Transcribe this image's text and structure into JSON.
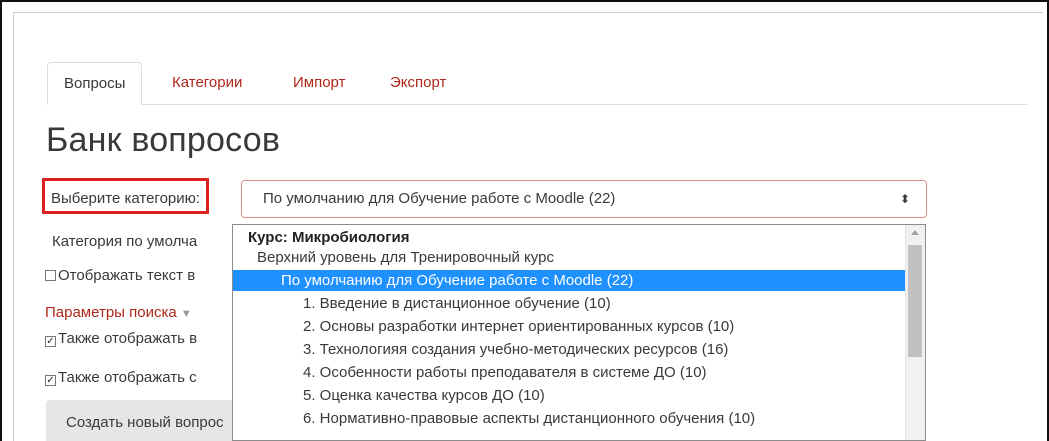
{
  "tabs": [
    {
      "label": "Вопросы",
      "active": true
    },
    {
      "label": "Категории",
      "active": false
    },
    {
      "label": "Импорт",
      "active": false
    },
    {
      "label": "Экспорт",
      "active": false
    }
  ],
  "page_title": "Банк вопросов",
  "category_label": "Выберите категорию:",
  "category_select": {
    "selected_value": "По умолчанию для Обучение работе с Moodle (22)",
    "options": [
      {
        "label": "Курс: Микробиология",
        "type": "group"
      },
      {
        "label": "Верхний уровень для Тренировочный курс",
        "type": "option"
      },
      {
        "label": "По умолчанию для Обучение работе с Moodle (22)",
        "type": "option",
        "selected": true
      },
      {
        "label": "1. Введение в дистанционное обучение (10)",
        "type": "option"
      },
      {
        "label": "2. Основы разработки интернет ориентированных курсов (10)",
        "type": "option"
      },
      {
        "label": "3. Технологияя создания учебно-методических ресурсов (16)",
        "type": "option"
      },
      {
        "label": "4. Особенности работы преподавателя в системе ДО (10)",
        "type": "option"
      },
      {
        "label": "5. Оценка качества курсов ДО (10)",
        "type": "option"
      },
      {
        "label": "6. Нормативно-правовые аспекты дистанционного обучения (10)",
        "type": "option"
      }
    ]
  },
  "background": {
    "category_default": "Категория по умолча",
    "show_text_checkbox": "Отображать текст в",
    "search_params": "Параметры поиска",
    "also_show_1": "Также отображать в",
    "also_show_2": "Также отображать с",
    "create_button": "Создать новый вопрос"
  },
  "colors": {
    "link": "#b0281a",
    "highlight_border": "#e02020",
    "selected_option": "#1e90ff"
  }
}
